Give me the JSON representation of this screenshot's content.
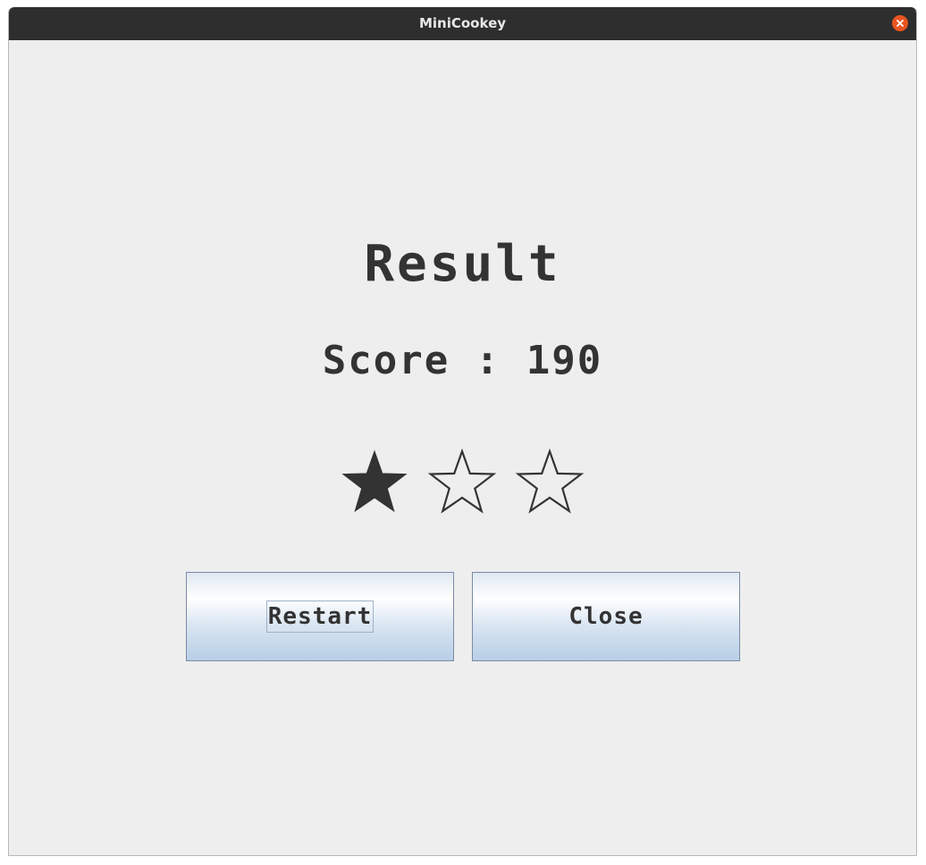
{
  "window": {
    "title": "MiniCookey"
  },
  "result": {
    "heading": "Result",
    "score_text": "Score : 190",
    "stars_earned": 1,
    "stars_total": 3
  },
  "buttons": {
    "restart_label": "Restart",
    "close_label": "Close"
  },
  "colors": {
    "titlebar": "#2f2e2e",
    "close_accent": "#e95420",
    "text": "#333333",
    "background": "#eeeeee"
  }
}
